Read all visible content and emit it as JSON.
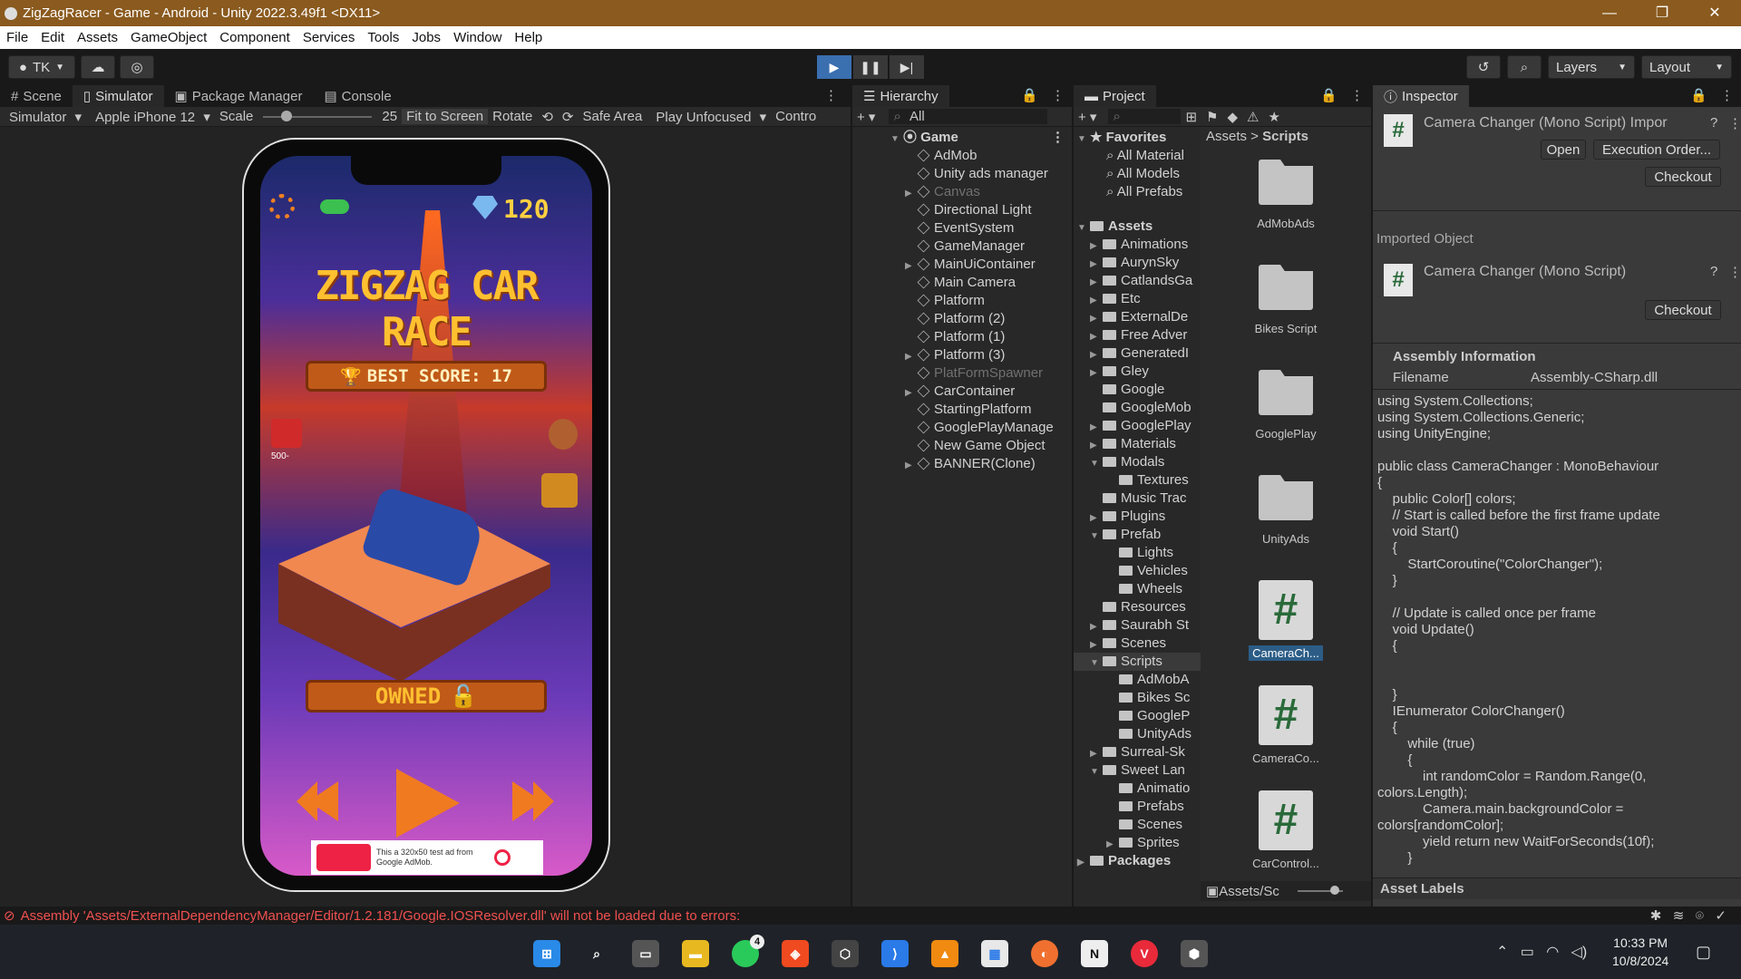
{
  "window": {
    "title": "ZigZagRacer - Game - Android - Unity 2022.3.49f1 <DX11>",
    "controls": [
      "—",
      "❐",
      "✕"
    ]
  },
  "menu": [
    "File",
    "Edit",
    "Assets",
    "GameObject",
    "Component",
    "Services",
    "Tools",
    "Jobs",
    "Window",
    "Help"
  ],
  "toolbar": {
    "account": "TK",
    "layers": "Layers",
    "layout": "Layout"
  },
  "gameTabs": [
    "Scene",
    "Simulator",
    "Package Manager",
    "Console"
  ],
  "simBar": {
    "simulator": "Simulator",
    "device": "Apple iPhone 12",
    "scale_label": "Scale",
    "scale_value": "25",
    "fit": "Fit to Screen",
    "rotate": "Rotate",
    "safe": "Safe Area",
    "play": "Play Unfocused",
    "control": "Contro"
  },
  "game": {
    "gems": "120",
    "title": "ZIGZAG CAR RACE",
    "best_score": "BEST SCORE: 17",
    "gift_label": "500-",
    "owned": "OWNED",
    "ad_text": "This a 320x50 test ad from Google AdMob."
  },
  "hierarchy": {
    "tab": "Hierarchy",
    "search": "All",
    "root": "Game",
    "items": [
      {
        "label": "AdMob",
        "arrow": "",
        "dim": false
      },
      {
        "label": "Unity ads manager",
        "arrow": "",
        "dim": false
      },
      {
        "label": "Canvas",
        "arrow": "▶",
        "dim": true
      },
      {
        "label": "Directional Light",
        "arrow": "",
        "dim": false
      },
      {
        "label": "EventSystem",
        "arrow": "",
        "dim": false
      },
      {
        "label": "GameManager",
        "arrow": "",
        "dim": false
      },
      {
        "label": "MainUiContainer",
        "arrow": "▶",
        "dim": false
      },
      {
        "label": "Main Camera",
        "arrow": "",
        "dim": false
      },
      {
        "label": "Platform",
        "arrow": "",
        "dim": false
      },
      {
        "label": "Platform (2)",
        "arrow": "",
        "dim": false
      },
      {
        "label": "Platform (1)",
        "arrow": "",
        "dim": false
      },
      {
        "label": "Platform (3)",
        "arrow": "▶",
        "dim": false
      },
      {
        "label": "PlatFormSpawner",
        "arrow": "",
        "dim": true
      },
      {
        "label": "CarContainer",
        "arrow": "▶",
        "dim": false
      },
      {
        "label": "StartingPlatform",
        "arrow": "",
        "dim": false
      },
      {
        "label": "GooglePlayManage",
        "arrow": "",
        "dim": false
      },
      {
        "label": "New Game Object",
        "arrow": "",
        "dim": false
      },
      {
        "label": "BANNER(Clone)",
        "arrow": "▶",
        "dim": false
      }
    ]
  },
  "project": {
    "tab": "Project",
    "favorites": "Favorites",
    "fav_items": [
      "All Material",
      "All Models",
      "All Prefabs"
    ],
    "assets_label": "Assets",
    "tree": [
      {
        "label": "Animations",
        "arrow": "▶",
        "indent": 1
      },
      {
        "label": "AurynSky",
        "arrow": "▶",
        "indent": 1
      },
      {
        "label": "CatlandsGa",
        "arrow": "▶",
        "indent": 1
      },
      {
        "label": "Etc",
        "arrow": "▶",
        "indent": 1
      },
      {
        "label": "ExternalDe",
        "arrow": "▶",
        "indent": 1
      },
      {
        "label": "Free Adver",
        "arrow": "▶",
        "indent": 1
      },
      {
        "label": "GeneratedI",
        "arrow": "▶",
        "indent": 1
      },
      {
        "label": "Gley",
        "arrow": "▶",
        "indent": 1
      },
      {
        "label": "Google",
        "arrow": "",
        "indent": 1
      },
      {
        "label": "GoogleMob",
        "arrow": "",
        "indent": 1
      },
      {
        "label": "GooglePlay",
        "arrow": "▶",
        "indent": 1
      },
      {
        "label": "Materials",
        "arrow": "▶",
        "indent": 1
      },
      {
        "label": "Modals",
        "arrow": "▼",
        "indent": 1
      },
      {
        "label": "Textures",
        "arrow": "",
        "indent": 2
      },
      {
        "label": "Music Trac",
        "arrow": "",
        "indent": 1
      },
      {
        "label": "Plugins",
        "arrow": "▶",
        "indent": 1
      },
      {
        "label": "Prefab",
        "arrow": "▼",
        "indent": 1
      },
      {
        "label": "Lights",
        "arrow": "",
        "indent": 2
      },
      {
        "label": "Vehicles",
        "arrow": "",
        "indent": 2
      },
      {
        "label": "Wheels",
        "arrow": "",
        "indent": 2
      },
      {
        "label": "Resources",
        "arrow": "",
        "indent": 1
      },
      {
        "label": "Saurabh St",
        "arrow": "▶",
        "indent": 1
      },
      {
        "label": "Scenes",
        "arrow": "▶",
        "indent": 1
      },
      {
        "label": "Scripts",
        "arrow": "▼",
        "indent": 1
      },
      {
        "label": "AdMobA",
        "arrow": "",
        "indent": 2
      },
      {
        "label": "Bikes Sc",
        "arrow": "",
        "indent": 2
      },
      {
        "label": "GoogleP",
        "arrow": "",
        "indent": 2
      },
      {
        "label": "UnityAds",
        "arrow": "",
        "indent": 2
      },
      {
        "label": "Surreal-Sk",
        "arrow": "▶",
        "indent": 1
      },
      {
        "label": "Sweet Lan",
        "arrow": "▼",
        "indent": 1
      },
      {
        "label": "Animatio",
        "arrow": "",
        "indent": 2
      },
      {
        "label": "Prefabs",
        "arrow": "",
        "indent": 2
      },
      {
        "label": "Scenes",
        "arrow": "",
        "indent": 2
      },
      {
        "label": "Sprites",
        "arrow": "▶",
        "indent": 2
      }
    ],
    "packages": "Packages",
    "breadcrumb_root": "Assets",
    "breadcrumb_leaf": "Scripts",
    "grid": [
      {
        "label": "AdMobAds",
        "type": "folder"
      },
      {
        "label": "Bikes Script",
        "type": "folder"
      },
      {
        "label": "GooglePlay",
        "type": "folder"
      },
      {
        "label": "UnityAds",
        "type": "folder"
      },
      {
        "label": "CameraCh...",
        "type": "script"
      },
      {
        "label": "CameraCo...",
        "type": "script"
      },
      {
        "label": "CarControl...",
        "type": "script"
      }
    ],
    "footer_path": "Assets/Sc"
  },
  "inspector": {
    "tab": "Inspector",
    "title": "Camera Changer (Mono Script) Impor",
    "open": "Open",
    "exec": "Execution Order...",
    "checkout": "Checkout",
    "imported": "Imported Object",
    "imported_title": "Camera Changer (Mono Script)",
    "assembly_info": "Assembly Information",
    "filename_label": "Filename",
    "filename_value": "Assembly-CSharp.dll",
    "asset_labels": "Asset Labels",
    "code": "using System.Collections;\nusing System.Collections.Generic;\nusing UnityEngine;\n\npublic class CameraChanger : MonoBehaviour\n{\n    public Color[] colors;\n    // Start is called before the first frame update\n    void Start()\n    {\n        StartCoroutine(\"ColorChanger\");\n    }\n\n    // Update is called once per frame\n    void Update()\n    {\n\n\n    }\n    IEnumerator ColorChanger()\n    {\n        while (true)\n        {\n            int randomColor = Random.Range(0,\ncolors.Length);\n            Camera.main.backgroundColor =\ncolors[randomColor];\n            yield return new WaitForSeconds(10f);\n        }"
  },
  "status": {
    "error": "Assembly 'Assets/ExternalDependencyManager/Editor/1.2.181/Google.IOSResolver.dll' will not be loaded due to errors:"
  },
  "taskbar": {
    "time": "10:33 PM",
    "date": "10/8/2024",
    "whatsapp_badge": "4"
  }
}
